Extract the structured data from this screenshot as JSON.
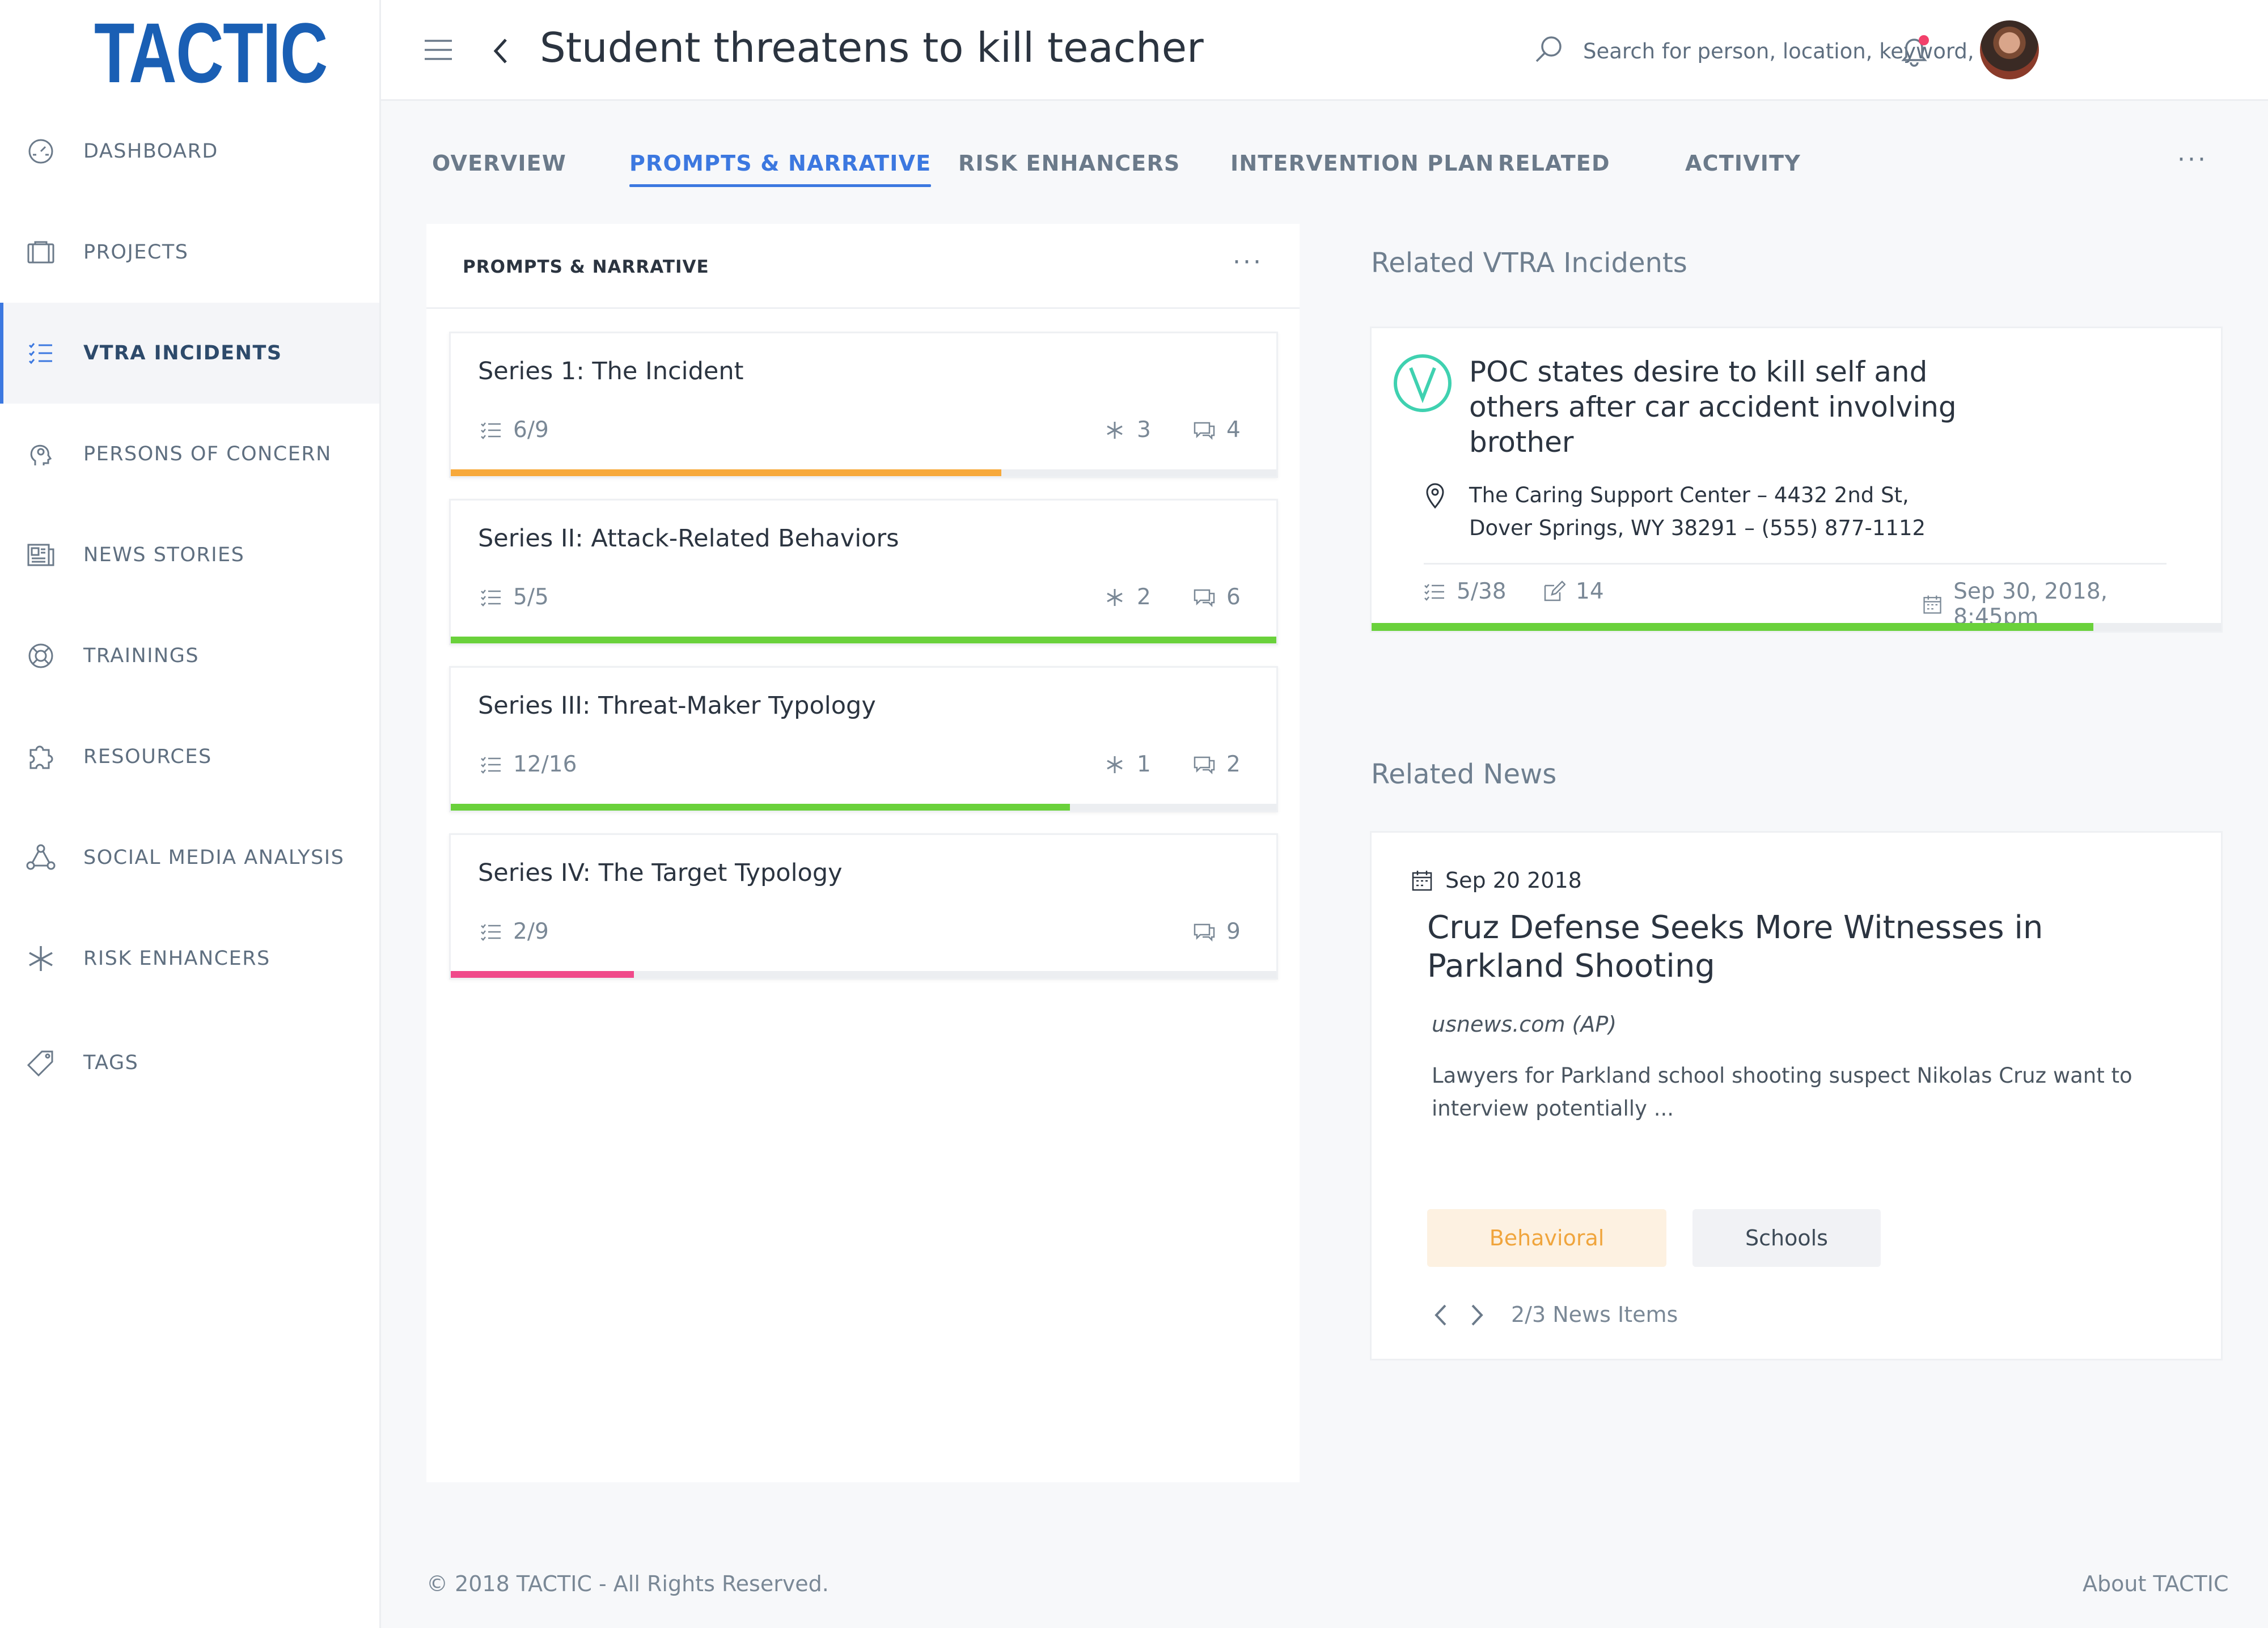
{
  "app": {
    "logo": "TACTIC",
    "page_title": "Student threatens to kill teacher"
  },
  "search": {
    "placeholder": "Search for person, location, keyword, etc."
  },
  "sidebar": {
    "items": [
      {
        "label": "DASHBOARD",
        "icon": "gauge-icon"
      },
      {
        "label": "PROJECTS",
        "icon": "folder-icon"
      },
      {
        "label": "VTRA INCIDENTS",
        "icon": "checklist-icon",
        "active": true
      },
      {
        "label": "PERSONS OF CONCERN",
        "icon": "head-icon"
      },
      {
        "label": "NEWS STORIES",
        "icon": "newspaper-icon"
      },
      {
        "label": "TRAININGS",
        "icon": "lifebuoy-icon"
      },
      {
        "label": "RESOURCES",
        "icon": "puzzle-icon"
      },
      {
        "label": "SOCIAL MEDIA ANALYSIS",
        "icon": "network-icon"
      },
      {
        "label": "RISK ENHANCERS",
        "icon": "asterisk-icon"
      },
      {
        "label": "TAGS",
        "icon": "tag-icon"
      }
    ]
  },
  "tabs": [
    {
      "label": "OVERVIEW"
    },
    {
      "label": "PROMPTS & NARRATIVE",
      "active": true
    },
    {
      "label": "RISK ENHANCERS"
    },
    {
      "label": "INTERVENTION PLAN"
    },
    {
      "label": "RELATED"
    },
    {
      "label": "ACTIVITY"
    }
  ],
  "more_label": "···",
  "prompts_panel": {
    "title": "PROMPTS & NARRATIVE",
    "series": [
      {
        "name": "Series 1: The Incident",
        "progress_text": "6/9",
        "risk_count": "3",
        "comment_count": "4",
        "progress": 0.667,
        "color": "#f7a93b"
      },
      {
        "name": "Series II: Attack-Related Behaviors",
        "progress_text": "5/5",
        "risk_count": "2",
        "comment_count": "6",
        "progress": 1.0,
        "color": "#6ad13b"
      },
      {
        "name": "Series III: Threat-Maker Typology",
        "progress_text": "12/16",
        "risk_count": "1",
        "comment_count": "2",
        "progress": 0.75,
        "color": "#6ad13b"
      },
      {
        "name": "Series IV: The Target Typology",
        "progress_text": "2/9",
        "risk_count": "",
        "comment_count": "9",
        "progress": 0.222,
        "color": "#f0498a"
      }
    ]
  },
  "related_incidents": {
    "section_title": "Related VTRA Incidents",
    "incident": {
      "title": "POC states desire to kill self and others after car accident involving brother",
      "address_line1": "The Caring Support Center – 4432 2nd St,",
      "address_line2": "Dover Springs, WY 38291 – (555) 877-1112",
      "progress_text": "5/38",
      "edit_count": "14",
      "date": "Sep 30, 2018, 8:45pm",
      "progress": 0.85,
      "color": "#6ad13b"
    }
  },
  "related_news": {
    "section_title": "Related News",
    "date": "Sep 20 2018",
    "title": "Cruz Defense Seeks More Witnesses in Parkland Shooting",
    "source": "usnews.com (AP)",
    "excerpt": "Lawyers for Parkland school shooting suspect Nikolas Cruz want to interview potentially ...",
    "tags": [
      "Behavioral",
      "Schools"
    ],
    "pager_text": "2/3 News Items"
  },
  "footer": {
    "copyright": "© 2018 TACTIC - All Rights Reserved.",
    "about": "About TACTIC"
  },
  "colors": {
    "accent": "#3c78e0",
    "brand": "#1a5fb4",
    "progress_orange": "#f7a93b",
    "progress_green": "#6ad13b",
    "progress_pink": "#f0498a",
    "notification_dot": "#f2416b",
    "vtra_logo": "#3fd1b0"
  }
}
